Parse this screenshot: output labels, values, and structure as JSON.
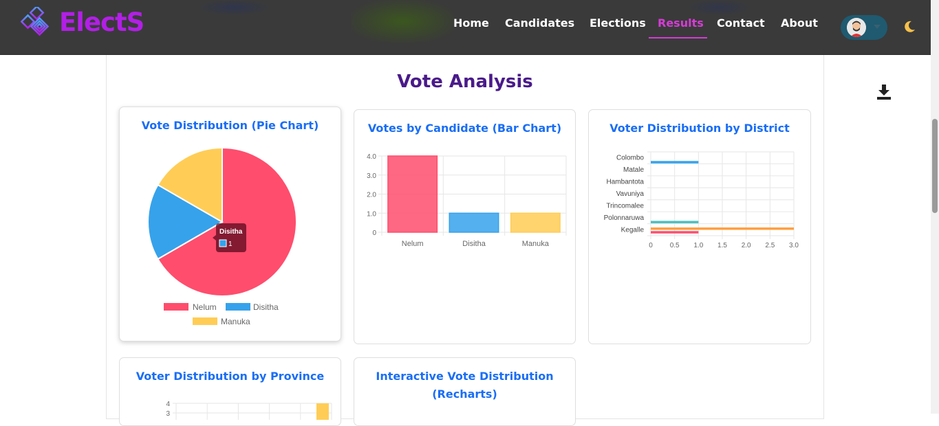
{
  "brand": {
    "name": "ElectS"
  },
  "nav": {
    "links": [
      {
        "label": "Home"
      },
      {
        "label": "Candidates"
      },
      {
        "label": "Elections"
      },
      {
        "label": "Results"
      },
      {
        "label": "Contact"
      },
      {
        "label": "About"
      }
    ],
    "active": "Results"
  },
  "page": {
    "title": "Vote Analysis"
  },
  "cards": {
    "pie": {
      "title": "Vote Distribution (Pie Chart)"
    },
    "bar": {
      "title": "Votes by Candidate (Bar Chart)"
    },
    "district": {
      "title": "Voter Distribution by District"
    },
    "province": {
      "title": "Voter Distribution by Province"
    },
    "recharts": {
      "title_line1": "Interactive Vote Distribution",
      "title_line2": "(Recharts)"
    }
  },
  "icons": {
    "download": "download-icon",
    "theme": "moon-icon",
    "avatar": "user-avatar-icon",
    "logo": "diamond-logo-icon"
  },
  "colors": {
    "nelum": "#ff4d6d",
    "disitha": "#36a2eb",
    "manuka": "#ffcd56",
    "teal": "#4bc0c0",
    "orange": "#ff9f40",
    "accent": "#d63cd6",
    "title": "#1a6ef5"
  },
  "tooltip": {
    "label": "Disitha",
    "value": "1"
  },
  "chart_data": [
    {
      "type": "pie",
      "title": "Vote Distribution (Pie Chart)",
      "categories": [
        "Nelum",
        "Disitha",
        "Manuka"
      ],
      "values": [
        4,
        1,
        1
      ],
      "legend": "bottom"
    },
    {
      "type": "bar",
      "title": "Votes by Candidate (Bar Chart)",
      "categories": [
        "Nelum",
        "Disitha",
        "Manuka"
      ],
      "values": [
        4,
        1,
        1
      ],
      "yticks": [
        "0",
        "1.0",
        "2.0",
        "3.0",
        "4.0"
      ],
      "ylim": [
        0,
        4
      ],
      "grid": true
    },
    {
      "type": "bar",
      "orientation": "horizontal",
      "title": "Voter Distribution by District",
      "categories": [
        "Colombo",
        "Matale",
        "Hambantota",
        "Vavuniya",
        "Trincomalee",
        "Polonnaruwa",
        "Kegalle"
      ],
      "series": [
        {
          "values": [
            1,
            0,
            0,
            0,
            0,
            0,
            0
          ]
        },
        {
          "values": [
            0,
            0,
            0,
            0,
            0,
            1,
            0
          ]
        },
        {
          "values": [
            0,
            0,
            0,
            0,
            0,
            0,
            3
          ]
        },
        {
          "values": [
            0,
            0,
            0,
            0,
            0,
            0,
            1
          ]
        }
      ],
      "xticks": [
        "0",
        "0.5",
        "1.0",
        "1.5",
        "2.0",
        "2.5",
        "3.0"
      ],
      "xlim": [
        0,
        3
      ],
      "grid": true
    },
    {
      "type": "bar",
      "title": "Voter Distribution by Province",
      "yticks": [
        "4",
        "3"
      ],
      "visible_partial": true
    }
  ]
}
